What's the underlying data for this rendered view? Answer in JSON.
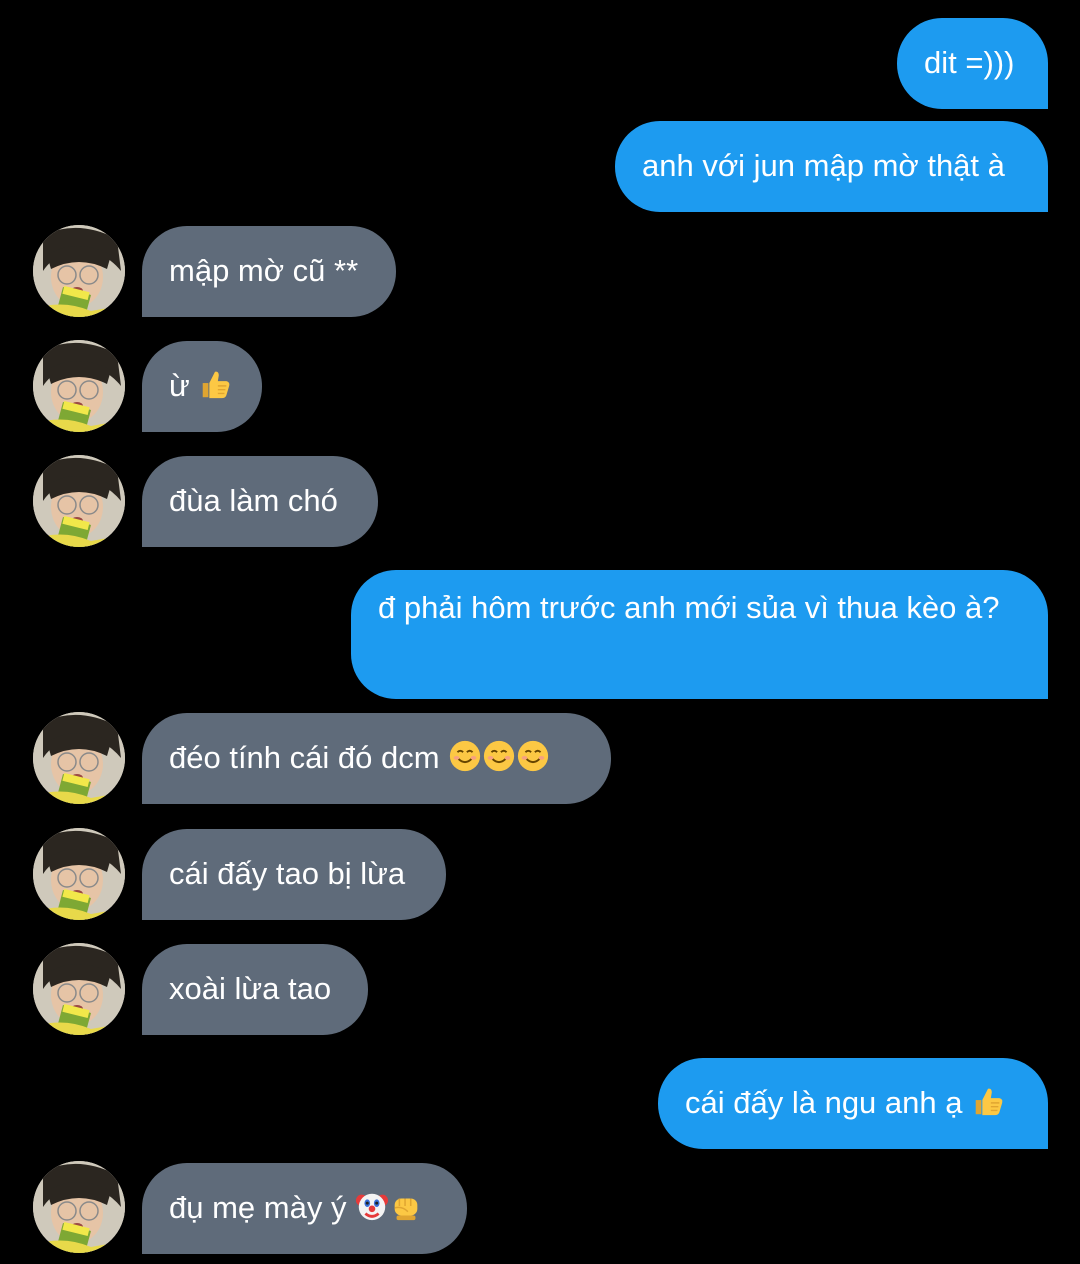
{
  "colors": {
    "background": "#000000",
    "sent_bubble": "#1d9bf0",
    "received_bubble": "#5f6b7a",
    "text": "#ffffff"
  },
  "messages": [
    {
      "direction": "sent",
      "text": "dit =)))"
    },
    {
      "direction": "sent",
      "text": "anh với jun mập mờ thật à"
    },
    {
      "direction": "received",
      "text": "mập mờ cũ **"
    },
    {
      "direction": "received",
      "text": "ừ",
      "emojis": [
        "thumbs-up"
      ]
    },
    {
      "direction": "received",
      "text": "đùa làm chó"
    },
    {
      "direction": "sent",
      "text": "đ phải hôm trước anh mới sủa vì thua kèo à?"
    },
    {
      "direction": "received",
      "text": "đéo tính cái đó dcm",
      "emojis": [
        "smiling-face",
        "smiling-face",
        "smiling-face"
      ]
    },
    {
      "direction": "received",
      "text": "cái đấy tao bị lừa"
    },
    {
      "direction": "received",
      "text": "xoài lừa tao"
    },
    {
      "direction": "sent",
      "text": "cái đấy là ngu anh ạ",
      "emojis": [
        "thumbs-up"
      ]
    },
    {
      "direction": "received",
      "text": "đụ mẹ mày ý",
      "emojis": [
        "clown-face",
        "oncoming-fist"
      ]
    }
  ]
}
